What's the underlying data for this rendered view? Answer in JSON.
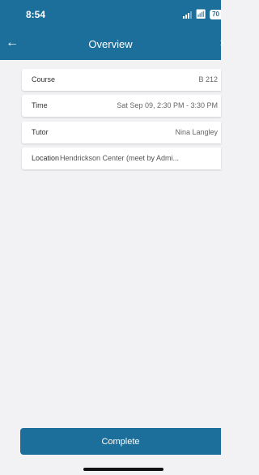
{
  "status_bar": {
    "time": "8:54",
    "battery": "70"
  },
  "nav": {
    "title": "Overview",
    "back_icon": "arrow-left-icon",
    "forward_icon": "chevron-right-icon"
  },
  "details": [
    {
      "label": "Course",
      "value": "B 212"
    },
    {
      "label": "Time",
      "value": "Sat Sep 09, 2:30 PM - 3:30 PM"
    },
    {
      "label": "Tutor",
      "value": "Nina Langley"
    },
    {
      "label": "Location",
      "value": "Hendrickson Center (meet by Admi..."
    }
  ],
  "actions": {
    "complete_label": "Complete"
  },
  "colors": {
    "brand": "#1d6f9b",
    "background": "#f2f2f4"
  }
}
